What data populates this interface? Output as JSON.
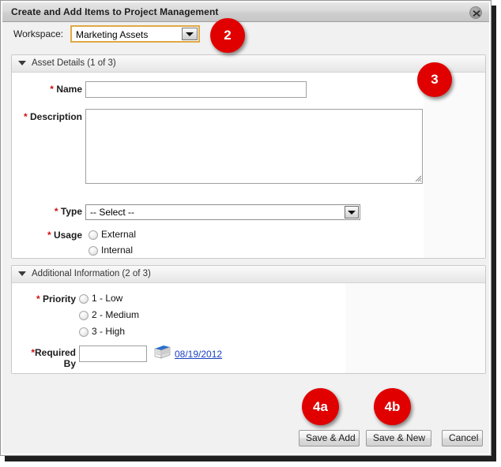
{
  "window": {
    "title": "Create and Add Items to Project Management",
    "close_icon": "close-icon"
  },
  "workspace": {
    "label": "Workspace:",
    "value": "Marketing Assets",
    "focus_border_color": "#e0a945"
  },
  "sections": [
    {
      "title": "Asset Details (1 of 3)",
      "fields": {
        "name": {
          "label": "Name",
          "required": "*",
          "value": ""
        },
        "description": {
          "label": "Description",
          "required": "*",
          "value": ""
        },
        "type": {
          "label": "Type",
          "required": "*",
          "value": "-- Select --"
        },
        "usage": {
          "label": "Usage",
          "required": "*",
          "options": [
            "External",
            "Internal"
          ]
        }
      }
    },
    {
      "title": "Additional Information (2 of 3)",
      "fields": {
        "priority": {
          "label": "Priority",
          "required": "*",
          "options": [
            "1 - Low",
            "2 - Medium",
            "3 - High"
          ]
        },
        "required_by": {
          "label_line1": "Required",
          "label_line2": "By",
          "required": "*",
          "value": "",
          "calendar_icon": "calendar-icon",
          "calendar_link": "08/19/2012"
        }
      }
    }
  ],
  "footer": {
    "save_and_add": "Save & Add",
    "save_and_new": "Save & New",
    "cancel": "Cancel"
  },
  "callouts": [
    {
      "id": "2",
      "text": "2"
    },
    {
      "id": "3",
      "text": "3"
    },
    {
      "id": "4a",
      "text": "4a"
    },
    {
      "id": "4b",
      "text": "4b"
    }
  ],
  "colors": {
    "callout_red": "#e00000",
    "required_red": "#d01010",
    "link_blue": "#1a3fbf"
  }
}
